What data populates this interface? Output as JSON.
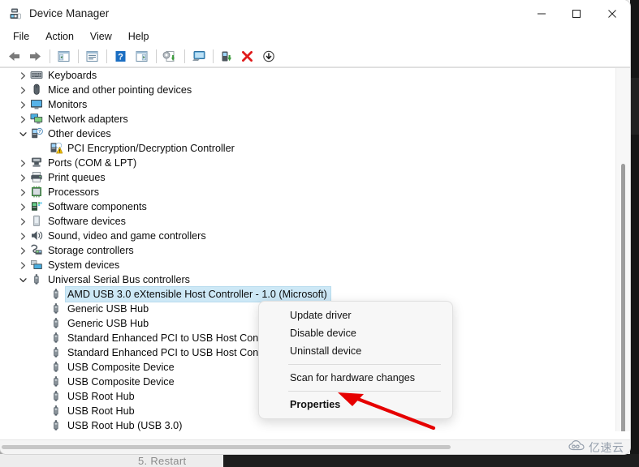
{
  "window": {
    "title": "Device Manager",
    "app_icon": "device-manager-icon",
    "controls": {
      "minimize_label": "—",
      "maximize_label": "□",
      "close_label": "✕"
    }
  },
  "menubar": {
    "items": [
      {
        "label": "File"
      },
      {
        "label": "Action"
      },
      {
        "label": "View"
      },
      {
        "label": "Help"
      }
    ]
  },
  "toolbar": {
    "buttons": [
      {
        "name": "back-icon",
        "tip": "Back"
      },
      {
        "name": "forward-icon",
        "tip": "Forward"
      },
      {
        "name": "show-hide-console-tree-icon",
        "tip": "Show/Hide Console Tree"
      },
      {
        "name": "properties-icon",
        "tip": "Properties"
      },
      {
        "name": "help-icon",
        "tip": "Help"
      },
      {
        "name": "show-hide-action-pane-icon",
        "tip": "Show/Hide Action Pane"
      },
      {
        "name": "update-driver-icon",
        "tip": "Update Driver Software"
      },
      {
        "name": "scan-hardware-changes-icon",
        "tip": "Scan for hardware changes"
      },
      {
        "name": "enable-device-icon",
        "tip": "Enable device"
      },
      {
        "name": "uninstall-device-icon",
        "tip": "Uninstall device"
      },
      {
        "name": "disable-device-icon",
        "tip": "Disable device"
      }
    ]
  },
  "tree": {
    "rows": [
      {
        "label": "",
        "icon": "partial-row-icon",
        "depth": 0,
        "twisty": "",
        "selected": false,
        "partial": true
      },
      {
        "label": "Keyboards",
        "icon": "keyboard-icon",
        "depth": 0,
        "twisty": "collapsed",
        "selected": false
      },
      {
        "label": "Mice and other pointing devices",
        "icon": "mouse-icon",
        "depth": 0,
        "twisty": "collapsed",
        "selected": false
      },
      {
        "label": "Monitors",
        "icon": "monitor-icon",
        "depth": 0,
        "twisty": "collapsed",
        "selected": false
      },
      {
        "label": "Network adapters",
        "icon": "network-adapter-icon",
        "depth": 0,
        "twisty": "collapsed",
        "selected": false
      },
      {
        "label": "Other devices",
        "icon": "other-devices-icon",
        "depth": 0,
        "twisty": "expanded",
        "selected": false
      },
      {
        "label": "PCI Encryption/Decryption Controller",
        "icon": "warning-device-icon",
        "depth": 1,
        "twisty": "",
        "selected": false
      },
      {
        "label": "Ports (COM & LPT)",
        "icon": "port-icon",
        "depth": 0,
        "twisty": "collapsed",
        "selected": false
      },
      {
        "label": "Print queues",
        "icon": "printer-icon",
        "depth": 0,
        "twisty": "collapsed",
        "selected": false
      },
      {
        "label": "Processors",
        "icon": "processor-icon",
        "depth": 0,
        "twisty": "collapsed",
        "selected": false
      },
      {
        "label": "Software components",
        "icon": "software-component-icon",
        "depth": 0,
        "twisty": "collapsed",
        "selected": false
      },
      {
        "label": "Software devices",
        "icon": "software-device-icon",
        "depth": 0,
        "twisty": "collapsed",
        "selected": false
      },
      {
        "label": "Sound, video and game controllers",
        "icon": "sound-icon",
        "depth": 0,
        "twisty": "collapsed",
        "selected": false
      },
      {
        "label": "Storage controllers",
        "icon": "storage-controller-icon",
        "depth": 0,
        "twisty": "collapsed",
        "selected": false
      },
      {
        "label": "System devices",
        "icon": "system-device-icon",
        "depth": 0,
        "twisty": "collapsed",
        "selected": false
      },
      {
        "label": "Universal Serial Bus controllers",
        "icon": "usb-icon",
        "depth": 0,
        "twisty": "expanded",
        "selected": false
      },
      {
        "label": "AMD USB 3.0 eXtensible Host Controller - 1.0 (Microsoft)",
        "icon": "usb-icon",
        "depth": 1,
        "twisty": "",
        "selected": true
      },
      {
        "label": "Generic USB Hub",
        "icon": "usb-icon",
        "depth": 1,
        "twisty": "",
        "selected": false
      },
      {
        "label": "Generic USB Hub",
        "icon": "usb-icon",
        "depth": 1,
        "twisty": "",
        "selected": false
      },
      {
        "label": "Standard Enhanced PCI to USB Host Controller",
        "icon": "usb-icon",
        "depth": 1,
        "twisty": "",
        "selected": false
      },
      {
        "label": "Standard Enhanced PCI to USB Host Controller",
        "icon": "usb-icon",
        "depth": 1,
        "twisty": "",
        "selected": false
      },
      {
        "label": "USB Composite Device",
        "icon": "usb-icon",
        "depth": 1,
        "twisty": "",
        "selected": false
      },
      {
        "label": "USB Composite Device",
        "icon": "usb-icon",
        "depth": 1,
        "twisty": "",
        "selected": false
      },
      {
        "label": "USB Root Hub",
        "icon": "usb-icon",
        "depth": 1,
        "twisty": "",
        "selected": false
      },
      {
        "label": "USB Root Hub",
        "icon": "usb-icon",
        "depth": 1,
        "twisty": "",
        "selected": false
      },
      {
        "label": "USB Root Hub (USB 3.0)",
        "icon": "usb-icon",
        "depth": 1,
        "twisty": "",
        "selected": false
      }
    ]
  },
  "context_menu": {
    "items": [
      {
        "label": "Update driver",
        "bold": false,
        "separator_after": false
      },
      {
        "label": "Disable device",
        "bold": false,
        "separator_after": false
      },
      {
        "label": "Uninstall device",
        "bold": false,
        "separator_after": true
      },
      {
        "label": "Scan for hardware changes",
        "bold": false,
        "separator_after": true
      },
      {
        "label": "Properties",
        "bold": true,
        "separator_after": false
      }
    ]
  },
  "annotation": {
    "arrow_color": "#e60000",
    "points_at": "Properties"
  },
  "watermark": {
    "text": "亿速云",
    "icon": "cloud-icon",
    "color": "#8d98a6"
  },
  "background": {
    "ghost_text": "5. Restart"
  },
  "colors": {
    "selection": "#cde8f6",
    "window_bg": "#ffffff",
    "menu_bg": "#f7f7f7",
    "accent_red": "#e60000",
    "warning_yellow": "#f2c200"
  }
}
